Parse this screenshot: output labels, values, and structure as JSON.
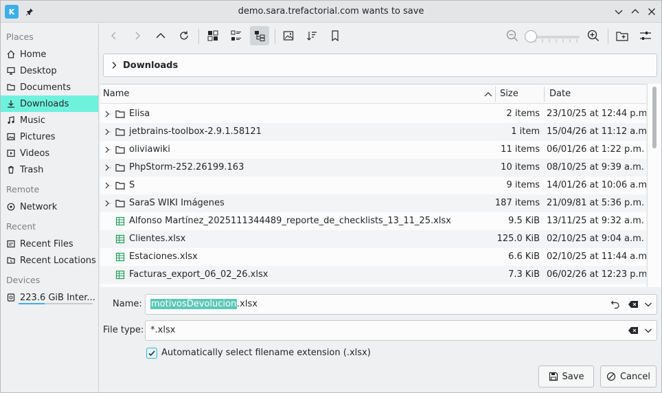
{
  "window": {
    "title": "demo.sara.trefactorial.com wants to save"
  },
  "sidebar": {
    "sections": {
      "places": "Places",
      "remote": "Remote",
      "recent": "Recent",
      "devices": "Devices"
    },
    "places": [
      {
        "label": "Home",
        "icon": "home-icon"
      },
      {
        "label": "Desktop",
        "icon": "desktop-icon"
      },
      {
        "label": "Documents",
        "icon": "documents-icon"
      },
      {
        "label": "Downloads",
        "icon": "downloads-icon"
      },
      {
        "label": "Music",
        "icon": "music-icon"
      },
      {
        "label": "Pictures",
        "icon": "pictures-icon"
      },
      {
        "label": "Videos",
        "icon": "videos-icon"
      },
      {
        "label": "Trash",
        "icon": "trash-icon"
      }
    ],
    "remote": [
      {
        "label": "Network",
        "icon": "network-icon"
      }
    ],
    "recent": [
      {
        "label": "Recent Files",
        "icon": "recent-files-icon"
      },
      {
        "label": "Recent Locations",
        "icon": "recent-locations-icon"
      }
    ],
    "devices": [
      {
        "label": "223.6 GiB Inter...",
        "icon": "drive-icon",
        "usage": 0.35
      }
    ]
  },
  "breadcrumb": {
    "current": "Downloads"
  },
  "table": {
    "columns": {
      "name": "Name",
      "size": "Size",
      "date": "Date"
    },
    "rows": [
      {
        "name": "Elisa",
        "size": "2 items",
        "date": "23/10/25 at 12:44 p.m.",
        "type": "folder"
      },
      {
        "name": "jetbrains-toolbox-2.9.1.58121",
        "size": "1 item",
        "date": "15/04/26 at 11:12 a.m.",
        "type": "folder"
      },
      {
        "name": "oliviawiki",
        "size": "11 items",
        "date": "06/01/26 at 1:22 p.m.",
        "type": "folder"
      },
      {
        "name": "PhpStorm-252.26199.163",
        "size": "10 items",
        "date": "08/10/25 at 9:39 a.m.",
        "type": "folder"
      },
      {
        "name": "S",
        "size": "9 items",
        "date": "14/01/26 at 10:06 a.m.",
        "type": "folder"
      },
      {
        "name": "SaraS WIKI Imágenes",
        "size": "187 items",
        "date": "21/09/81 at 5:36 p.m.",
        "type": "folder"
      },
      {
        "name": "Alfonso Martínez_2025111344489_reporte_de_checklists_13_11_25.xlsx",
        "size": "9.5 KiB",
        "date": "13/11/25 at 9:32 a.m.",
        "type": "xlsx"
      },
      {
        "name": "Clientes.xlsx",
        "size": "125.0 KiB",
        "date": "02/10/25 at 9:04 a.m.",
        "type": "xlsx"
      },
      {
        "name": "Estaciones.xlsx",
        "size": "6.6 KiB",
        "date": "02/10/25 at 11:44 a.m.",
        "type": "xlsx"
      },
      {
        "name": "Facturas_export_06_02_26.xlsx",
        "size": "7.3 KiB",
        "date": "06/02/26 at 12:23 p.m.",
        "type": "xlsx"
      }
    ]
  },
  "form": {
    "name_label": "Name:",
    "name_selected": "motivosDevolucion",
    "name_ext": ".xlsx",
    "filetype_label": "File type:",
    "filetype_value": "*.xlsx",
    "auto_ext_label": "Automatically select filename extension (.xlsx)",
    "auto_ext_checked": true
  },
  "buttons": {
    "save": "Save",
    "cancel": "Cancel"
  },
  "colors": {
    "accent": "#3daee9",
    "active_place": "#6ff2dd",
    "selection": "#5cc8b8",
    "spreadsheet": "#1e9e5a"
  }
}
